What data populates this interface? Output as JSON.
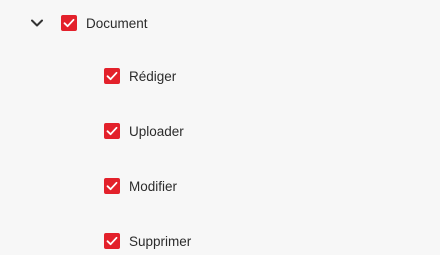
{
  "colors": {
    "accent": "#e3212b",
    "panel_background": "#f7f7f7",
    "text": "#2b2b2b",
    "chevron": "#333333"
  },
  "tree": {
    "parent": {
      "label": "Document",
      "expanded": true,
      "checked": true,
      "expand_icon": "chevron-down-icon"
    },
    "children": [
      {
        "label": "Rédiger",
        "checked": true
      },
      {
        "label": "Uploader",
        "checked": true
      },
      {
        "label": "Modifier",
        "checked": true
      },
      {
        "label": "Supprimer",
        "checked": true
      }
    ]
  }
}
